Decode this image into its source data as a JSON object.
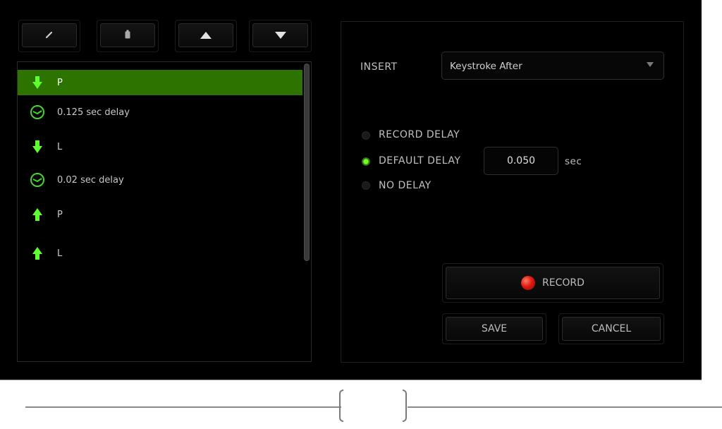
{
  "toolbar": {
    "buttons": [
      {
        "name": "edit",
        "icon": "pencil-icon"
      },
      {
        "name": "delete",
        "icon": "trash-icon"
      },
      {
        "name": "move-up",
        "icon": "triangle-up-icon"
      },
      {
        "name": "move-down",
        "icon": "triangle-down-icon"
      }
    ]
  },
  "macro_list": {
    "items": [
      {
        "type": "key-down",
        "icon": "arrow-down-icon",
        "label": "P",
        "selected": true
      },
      {
        "type": "delay",
        "icon": "clock-icon",
        "label": "0.125 sec delay",
        "selected": false
      },
      {
        "type": "key-down",
        "icon": "arrow-down-icon",
        "label": "L",
        "selected": false
      },
      {
        "type": "delay",
        "icon": "clock-icon",
        "label": "0.02 sec delay",
        "selected": false
      },
      {
        "type": "key-up",
        "icon": "arrow-up-icon",
        "label": "P",
        "selected": false
      },
      {
        "type": "key-up",
        "icon": "arrow-up-icon",
        "label": "L",
        "selected": false
      }
    ]
  },
  "settings": {
    "insert_label": "INSERT",
    "insert_value": "Keystroke After",
    "delay_options": [
      {
        "label": "RECORD DELAY",
        "checked": false
      },
      {
        "label": "DEFAULT DELAY",
        "checked": true
      },
      {
        "label": "NO DELAY",
        "checked": false
      }
    ],
    "default_delay_value": "0.050",
    "delay_unit": "sec",
    "record_label": "RECORD",
    "save_label": "SAVE",
    "cancel_label": "CANCEL"
  },
  "colors": {
    "accent_green": "#44d62c",
    "selected_row": "#2d7300",
    "record_red": "#e01b10"
  }
}
